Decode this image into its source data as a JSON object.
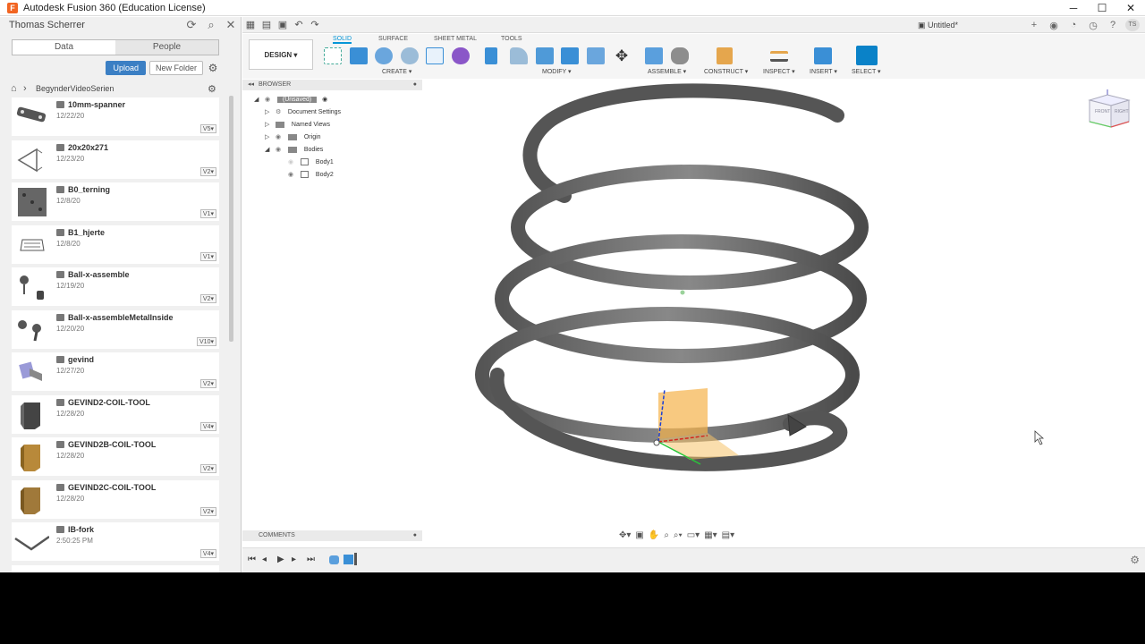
{
  "window": {
    "title": "Autodesk Fusion 360 (Education License)",
    "app_icon": "F"
  },
  "data_panel": {
    "user": "Thomas Scherrer",
    "tabs": [
      "Data",
      "People"
    ],
    "upload_label": "Upload",
    "new_folder_label": "New Folder",
    "breadcrumb": "BegynderVideoSerien",
    "files": [
      {
        "name": "10mm-spanner",
        "date": "12/22/20",
        "version": "V5"
      },
      {
        "name": "20x20x271",
        "date": "12/23/20",
        "version": "V2"
      },
      {
        "name": "B0_terning",
        "date": "12/8/20",
        "version": "V1"
      },
      {
        "name": "B1_hjerte",
        "date": "12/8/20",
        "version": "V1"
      },
      {
        "name": "Ball-x-assemble",
        "date": "12/19/20",
        "version": "V2"
      },
      {
        "name": "Ball-x-assembleMetalInside",
        "date": "12/20/20",
        "version": "V10"
      },
      {
        "name": "gevind",
        "date": "12/27/20",
        "version": "V2"
      },
      {
        "name": "GEVIND2-COIL-TOOL",
        "date": "12/28/20",
        "version": "V4"
      },
      {
        "name": "GEVIND2B-COIL-TOOL",
        "date": "12/28/20",
        "version": "V2"
      },
      {
        "name": "GEVIND2C-COIL-TOOL",
        "date": "12/28/20",
        "version": "V2"
      },
      {
        "name": "IB-fork",
        "date": "2:50:25 PM",
        "version": "V4"
      }
    ]
  },
  "document": {
    "title": "Untitled*"
  },
  "ribbon": {
    "workspace": "DESIGN ▾",
    "tabs": [
      "SOLID",
      "SURFACE",
      "SHEET METAL",
      "TOOLS"
    ],
    "groups": [
      "CREATE ▾",
      "MODIFY ▾",
      "ASSEMBLE ▾",
      "CONSTRUCT ▾",
      "INSPECT ▾",
      "INSERT ▾",
      "SELECT ▾"
    ]
  },
  "browser": {
    "title": "BROWSER",
    "root": "(Unsaved)",
    "items": [
      "Document Settings",
      "Named Views",
      "Origin",
      "Bodies",
      "Body1",
      "Body2"
    ]
  },
  "comments": {
    "title": "COMMENTS"
  },
  "viewcube": {
    "front": "FRONT",
    "right": "RIGHT"
  },
  "user_initials": "TS"
}
